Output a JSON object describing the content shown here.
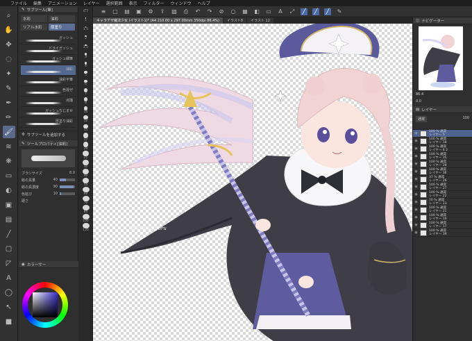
{
  "menu": [
    "ファイル",
    "編集",
    "アニメーション",
    "レイヤー",
    "選択範囲",
    "表示",
    "フィルター",
    "ウィンドウ",
    "ヘルプ"
  ],
  "subtool": {
    "header": "サブツール[筆]",
    "tabs": [
      "水彩",
      "油彩",
      "リアル水彩",
      "厚塗り"
    ],
    "brushes": [
      "ガッシュ",
      "ドライガッシュ",
      "ガッシュ細筆",
      "油彩",
      "油彩平筆",
      "色混ぜ",
      "点描",
      "ガッシュなじませ",
      "厚塗り油彩"
    ],
    "selected_brush_index": 3,
    "add_label": "サブツールを追加する"
  },
  "tool_property": {
    "header": "ツールプロパティ[油彩]",
    "brush_size_label": "ブラシサイズ",
    "brush_size_value": "8.0",
    "rows": [
      {
        "label": "絵の具量",
        "value": "40"
      },
      {
        "label": "絵の具濃度",
        "value": "90"
      },
      {
        "label": "色延び",
        "value": "10"
      }
    ],
    "hardness_label": "硬さ"
  },
  "color": {
    "header": "カラーサー"
  },
  "brush_sizes": [
    "0.7",
    "1",
    "1.5",
    "2",
    "2.5",
    "3",
    "4",
    "5",
    "6",
    "7",
    "8",
    "10",
    "12",
    "15",
    "17",
    "20",
    "25",
    "30",
    "40",
    "50",
    "60",
    "70",
    "80",
    "100",
    "120"
  ],
  "doc_tabs": [
    "キャラデザ魔法少女 (イラスト1)* (A4 210.00 x 297.00mm 350dpi 86.4%)",
    "イラスト8",
    "イラスト 12"
  ],
  "canvas": {
    "signature": "@Xomiya_yoru"
  },
  "navigator": {
    "header": "ナビゲーター",
    "zoom": "86.4",
    "rotation": "0.0"
  },
  "layers": {
    "header": "レイヤー",
    "blend_mode": "通常",
    "opacity": "100",
    "items": [
      {
        "mode": "100 % 通常",
        "name": "レイヤー 5"
      },
      {
        "mode": "100 % 通常",
        "name": "レイヤー 18"
      },
      {
        "mode": "100 % 通常",
        "name": "レイヤー 6 2"
      },
      {
        "mode": "100 % 通常",
        "name": "レイヤー 35"
      },
      {
        "mode": "100 % 通常",
        "name": "レイヤー 28"
      },
      {
        "mode": "100 % 通常",
        "name": "レイヤー 36"
      },
      {
        "mode": "37 % 通常",
        "name": "レイヤー 26"
      },
      {
        "mode": "100 % 通常",
        "name": "レイヤー 27"
      },
      {
        "mode": "100 % 通常",
        "name": "レイヤー 22"
      },
      {
        "mode": "70 % 通常",
        "name": "レイヤー 23"
      },
      {
        "mode": "100 % 通常",
        "name": "レイヤー 21"
      },
      {
        "mode": "100 % 通常",
        "name": "レイヤー 19"
      },
      {
        "mode": "100 % 通常",
        "name": "レイヤー 17"
      },
      {
        "mode": "100 % 通常",
        "name": "レイヤー 39"
      }
    ],
    "selected_index": 0
  }
}
